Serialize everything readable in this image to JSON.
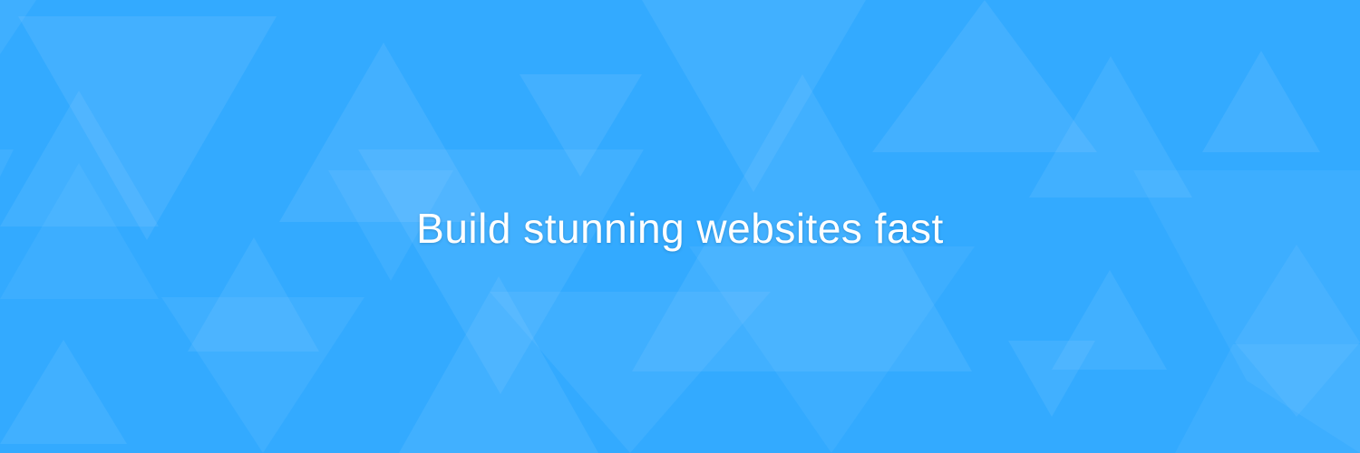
{
  "banner": {
    "headline": "Build stunning websites fast",
    "background_color": "#33aaff",
    "pattern": "translucent-triangles"
  }
}
